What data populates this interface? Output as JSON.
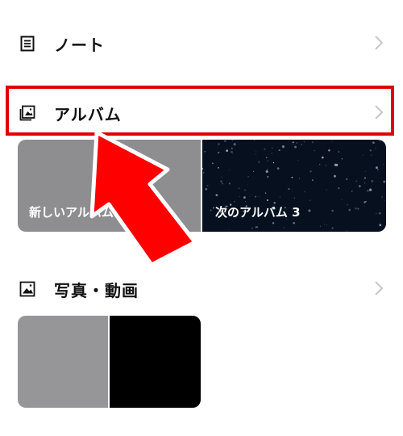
{
  "rows": {
    "note": {
      "label": "ノート",
      "icon": "note-icon"
    },
    "album": {
      "label": "アルバム",
      "icon": "album-icon"
    },
    "photos": {
      "label": "写真・動画",
      "icon": "photo-icon"
    }
  },
  "albums": [
    {
      "label": "新しいアルバム"
    },
    {
      "label": "次のアルバム 3"
    }
  ],
  "colors": {
    "highlight": "#e00000",
    "arrow": "#ff0000",
    "chevron": "#c7c7cc"
  }
}
